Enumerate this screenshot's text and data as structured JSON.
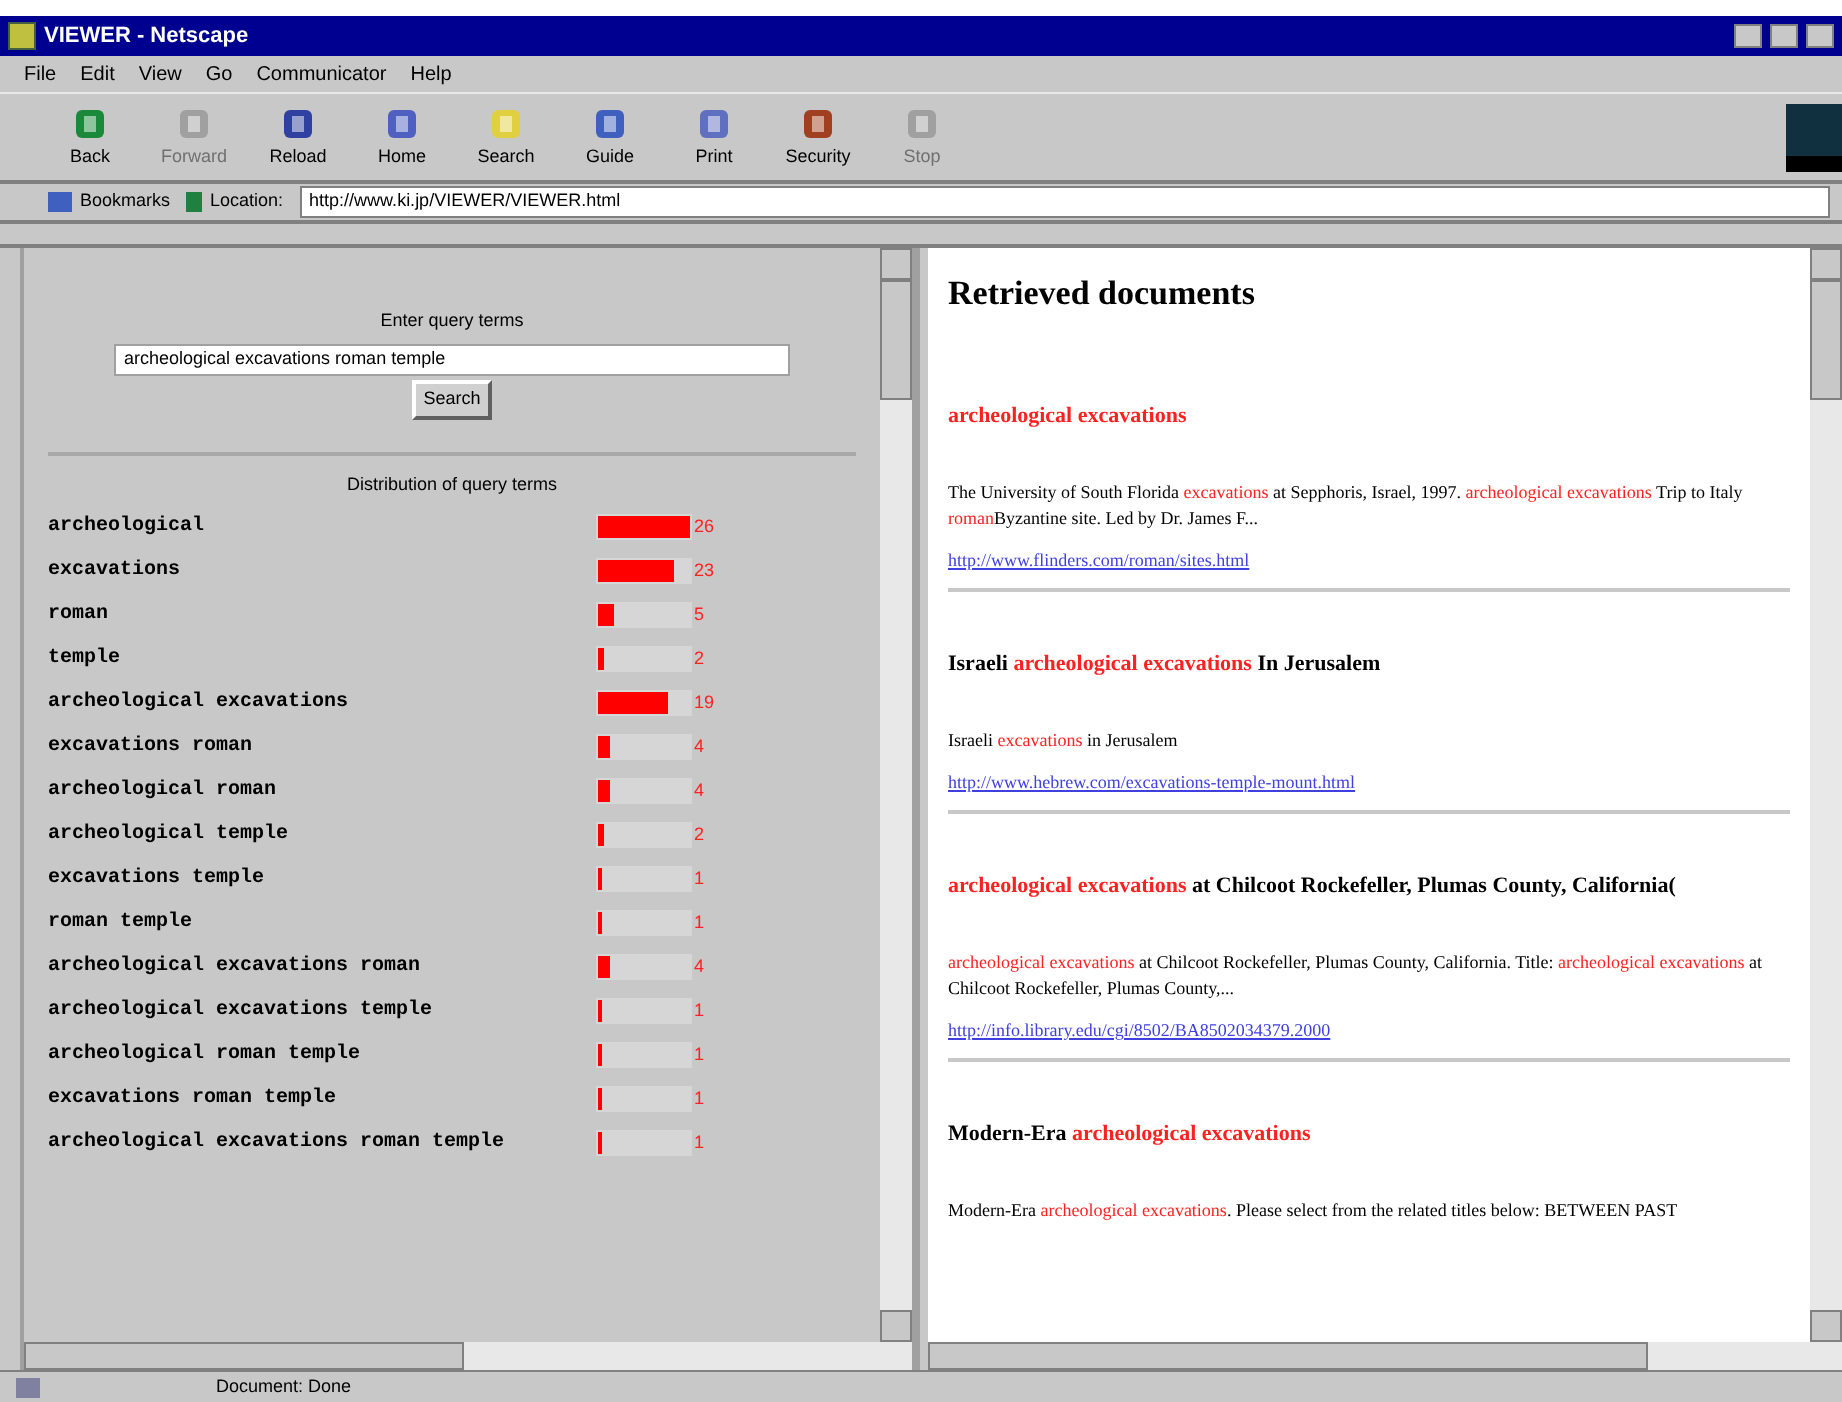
{
  "window": {
    "title": "VIEWER - Netscape"
  },
  "menu": [
    "File",
    "Edit",
    "View",
    "Go",
    "Communicator",
    "Help"
  ],
  "toolbar": [
    {
      "label": "Back",
      "disabled": false
    },
    {
      "label": "Forward",
      "disabled": true
    },
    {
      "label": "Reload",
      "disabled": false
    },
    {
      "label": "Home",
      "disabled": false
    },
    {
      "label": "Search",
      "disabled": false
    },
    {
      "label": "Guide",
      "disabled": false
    },
    {
      "label": "Print",
      "disabled": false
    },
    {
      "label": "Security",
      "disabled": false
    },
    {
      "label": "Stop",
      "disabled": true
    }
  ],
  "location_bar": {
    "bookmarks": "Bookmarks",
    "location_label": "Location:",
    "url": "http://www.ki.jp/VIEWER/VIEWER.html"
  },
  "query_panel": {
    "label": "Enter query terms",
    "query": "archeological excavations roman temple",
    "button": "Search",
    "distribution_title": "Distribution of query terms",
    "terms": [
      {
        "term": "archeological",
        "count": "26",
        "level": 1
      },
      {
        "term": "excavations",
        "count": "23",
        "level": 0.82
      },
      {
        "term": "roman",
        "count": "5",
        "level": 0.18
      },
      {
        "term": "temple",
        "count": "2",
        "level": 0.07
      },
      {
        "term": "archeological excavations",
        "count": "19",
        "level": 0.77
      },
      {
        "term": "excavations roman",
        "count": "4",
        "level": 0.14
      },
      {
        "term": "archeological roman",
        "count": "4",
        "level": 0.14
      },
      {
        "term": "archeological temple",
        "count": "2",
        "level": 0.07
      },
      {
        "term": "excavations temple",
        "count": "1",
        "level": 0.04
      },
      {
        "term": "roman temple",
        "count": "1",
        "level": 0.04
      },
      {
        "term": "archeological excavations roman",
        "count": "4",
        "level": 0.14
      },
      {
        "term": "archeological excavations temple",
        "count": "1",
        "level": 0.04
      },
      {
        "term": "archeological roman temple",
        "count": "1",
        "level": 0.04
      },
      {
        "term": "excavations roman temple",
        "count": "1",
        "level": 0.04
      },
      {
        "term": "archeological excavations roman temple",
        "count": "1",
        "level": 0.04
      }
    ]
  },
  "results": {
    "heading": "Retrieved documents",
    "documents": [
      {
        "title": [
          {
            "text": "archeological excavations",
            "highlight": true
          }
        ],
        "snippet": [
          {
            "text": "The University of South Florida ",
            "highlight": false
          },
          {
            "text": "excavations",
            "highlight": true
          },
          {
            "text": " at Sepphoris, Israel, 1997. ",
            "highlight": false
          },
          {
            "text": "archeological excavations",
            "highlight": true
          },
          {
            "text": " Trip to Italy ",
            "highlight": false
          },
          {
            "text": "roman",
            "highlight": true
          },
          {
            "text": "Byzantine site. Led by Dr. James F...",
            "highlight": false
          }
        ],
        "url": "http://www.flinders.com/roman/sites.html"
      },
      {
        "title": [
          {
            "text": "Israeli ",
            "highlight": false
          },
          {
            "text": "archeological excavations",
            "highlight": true
          },
          {
            "text": " In Jerusalem",
            "highlight": false
          }
        ],
        "snippet": [
          {
            "text": "Israeli ",
            "highlight": false
          },
          {
            "text": "excavations",
            "highlight": true
          },
          {
            "text": " in Jerusalem",
            "highlight": false
          }
        ],
        "url": "http://www.hebrew.com/excavations-temple-mount.html"
      },
      {
        "title": [
          {
            "text": "archeological excavations",
            "highlight": true
          },
          {
            "text": " at Chilcoot Rockefeller, Plumas County, California(",
            "highlight": false
          }
        ],
        "snippet": [
          {
            "text": "archeological excavations",
            "highlight": true
          },
          {
            "text": " at Chilcoot Rockefeller, Plumas County, California. Title: ",
            "highlight": false
          },
          {
            "text": "archeological excavations",
            "highlight": true
          },
          {
            "text": " at Chilcoot Rockefeller, Plumas County,...",
            "highlight": false
          }
        ],
        "url": "http://info.library.edu/cgi/8502/BA8502034379.2000"
      },
      {
        "title": [
          {
            "text": "Modern-Era ",
            "highlight": false
          },
          {
            "text": "archeological excavations",
            "highlight": true
          }
        ],
        "snippet": [
          {
            "text": "Modern-Era ",
            "highlight": false
          },
          {
            "text": "archeological excavations",
            "highlight": true
          },
          {
            "text": ". Please select from the related titles below: BETWEEN PAST",
            "highlight": false
          }
        ]
      }
    ]
  },
  "status_bar": {
    "text": "Document: Done"
  }
}
